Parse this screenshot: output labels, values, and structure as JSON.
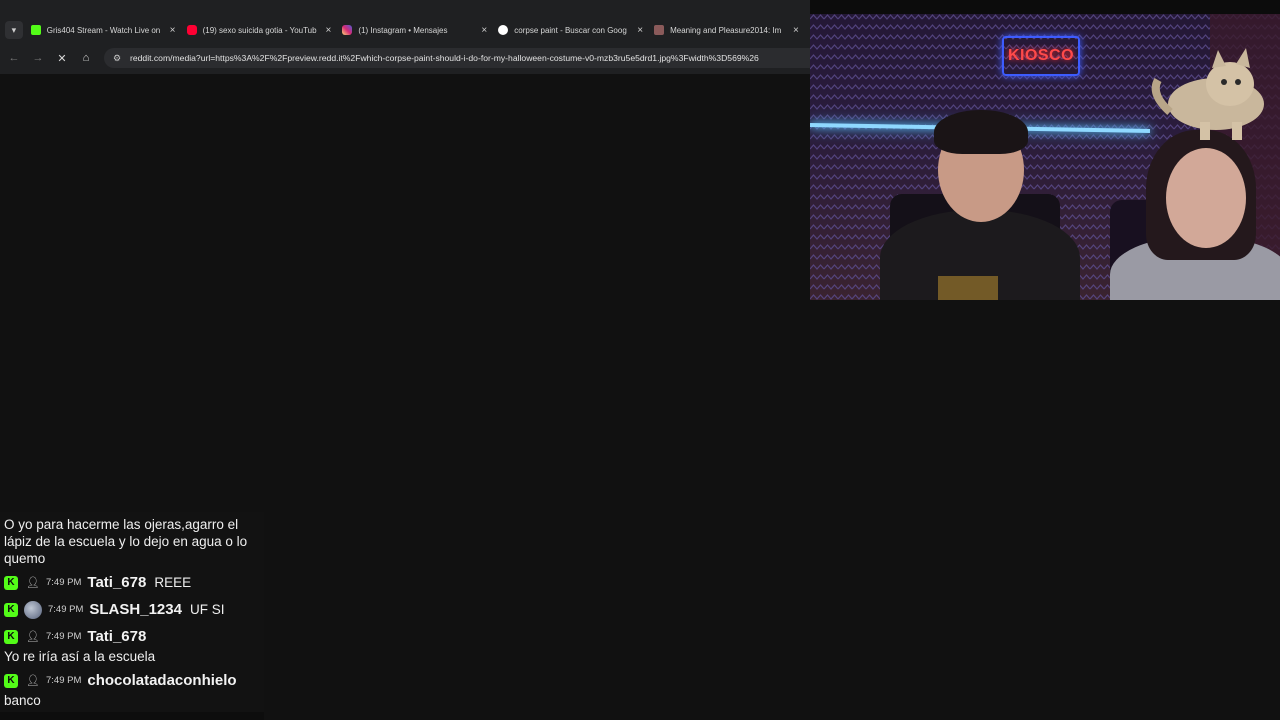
{
  "browser": {
    "tab_list_icon": "chevron-down-icon",
    "tabs": [
      {
        "title": "Gris404 Stream - Watch Live on",
        "favicon_color": "#53fc18",
        "close": "×"
      },
      {
        "title": "(19) sexo suicida gotia - YouTub",
        "favicon_color": "#ff0033",
        "close": "×"
      },
      {
        "title": "(1) Instagram • Mensajes",
        "favicon_color": "#d62976",
        "close": "×"
      },
      {
        "title": "corpse paint - Buscar con Goog",
        "favicon_color": "#ffffff",
        "close": "×"
      },
      {
        "title": "Meaning and Pleasure2014: Im",
        "favicon_color": "#8a5a5a",
        "close": "×"
      }
    ],
    "nav": {
      "back": "←",
      "forward": "→",
      "stop": "✕",
      "home": "⌂"
    },
    "url": "reddit.com/media?url=https%3A%2F%2Fpreview.redd.it%2Fwhich-corpse-paint-should-i-do-for-my-halloween-costume-v0-mzb3ru5e5drd1.jpg%3Fwidth%3D569%26"
  },
  "webcam": {
    "sign_text": "KIOSCO"
  },
  "chat": {
    "brand_color": "#53fc18",
    "partial_message": "O yo para hacerme las ojeras,agarro el lápiz de la escuela y lo dejo en agua o lo quemo",
    "messages": [
      {
        "time": "7:49 PM",
        "user": "Tati_678",
        "text": "REEE",
        "avatar": "person-icon"
      },
      {
        "time": "7:49 PM",
        "user": "SLASH_1234",
        "text": "UF SI",
        "avatar": "photo"
      },
      {
        "time": "7:49 PM",
        "user": "Tati_678",
        "text": "Yo re iría así a la escuela",
        "avatar": "person-icon"
      },
      {
        "time": "7:49 PM",
        "user": "chocolatadaconhielo",
        "text": "banco",
        "avatar": "person-icon"
      }
    ]
  }
}
